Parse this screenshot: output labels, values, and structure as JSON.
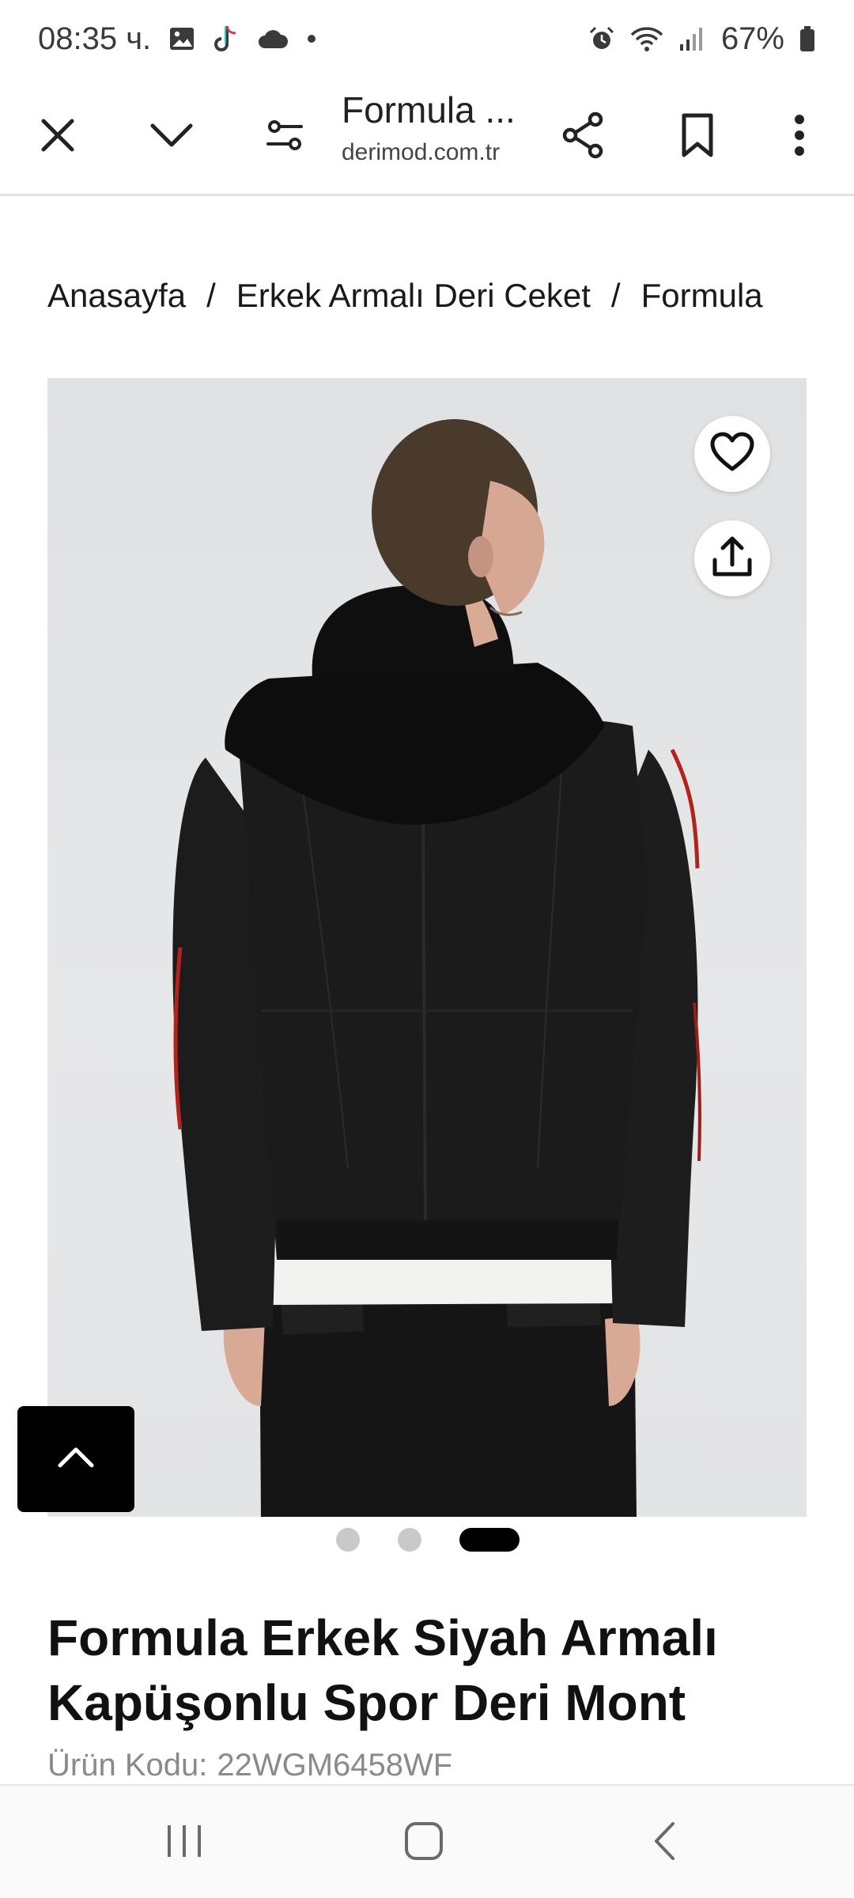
{
  "status_bar": {
    "time": "08:35 ч.",
    "battery": "67%",
    "icons": [
      "gallery-icon",
      "tiktok-icon",
      "cloud-icon",
      "dot-icon",
      "alarm-icon",
      "wifi-icon",
      "signal-icon",
      "battery-icon"
    ]
  },
  "toolbar": {
    "page_title": "Formula ...",
    "domain": "derimod.com.tr",
    "icons": [
      "close-icon",
      "chevron-down-icon",
      "page-settings-icon",
      "share-icon",
      "bookmark-icon",
      "more-vert-icon"
    ]
  },
  "breadcrumb": {
    "items": [
      "Anasayfa",
      "Erkek Armalı Deri Ceket",
      "Formula"
    ],
    "separator": "/"
  },
  "product": {
    "image_actions": [
      "heart-icon",
      "upload-share-icon"
    ],
    "carousel": {
      "count": 3,
      "active_index": 2
    },
    "title": "Formula Erkek Siyah Armalı Kapüşonlu Spor Deri Mont",
    "code_label": "Ürün Kodu:",
    "code_value": "22WGM6458WF"
  },
  "back_to_top": {
    "icon": "chevron-up-icon"
  },
  "nav_bar": {
    "icons": [
      "recent-apps-icon",
      "home-icon",
      "back-icon"
    ]
  },
  "colors": {
    "accent": "#000000",
    "image_bg": "#e3e4e6",
    "jacket": "#1c1c1c",
    "stripe": "#b3221b"
  }
}
